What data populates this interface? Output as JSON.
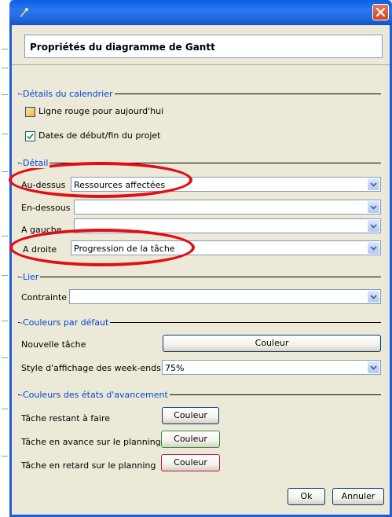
{
  "dialog": {
    "header_title": "Propriétés du diagramme de Gantt"
  },
  "calendar": {
    "section_title": "Détails du calendrier",
    "today_line_label": "Ligne rouge pour aujourd'hui",
    "today_line_checked": false,
    "project_dates_label": "Dates de début/fin du projet",
    "project_dates_checked": true
  },
  "detail": {
    "section_title": "Détail",
    "above_label": "Au-dessus",
    "above_value": "Ressources affectées",
    "below_label": "En-dessous",
    "below_value": "",
    "left_label": "A gauche",
    "left_value": "",
    "right_label": "A droite",
    "right_value": "Progression de la tâche"
  },
  "link": {
    "section_title": "Lier",
    "constraint_label": "Contrainte",
    "constraint_value": ""
  },
  "default_colors": {
    "section_title": "Couleurs par défaut",
    "new_task_label": "Nouvelle tâche",
    "new_task_button": "Couleur",
    "weekend_label": "Style d'affichage des week-ends",
    "weekend_value": "75%"
  },
  "progress_colors": {
    "section_title": "Couleurs des états d'avancement",
    "remaining_label": "Tâche restant à faire",
    "remaining_button": "Couleur",
    "ahead_label": "Tâche en avance sur le planning",
    "ahead_button": "Couleur",
    "late_label": "Tâche en retard sur le planning",
    "late_button": "Couleur"
  },
  "footer": {
    "ok_label": "Ok",
    "cancel_label": "Annuler"
  },
  "colors": {
    "accent": "#1d5fd6",
    "section_title": "#0046d5",
    "highlight": "#e20e15"
  }
}
